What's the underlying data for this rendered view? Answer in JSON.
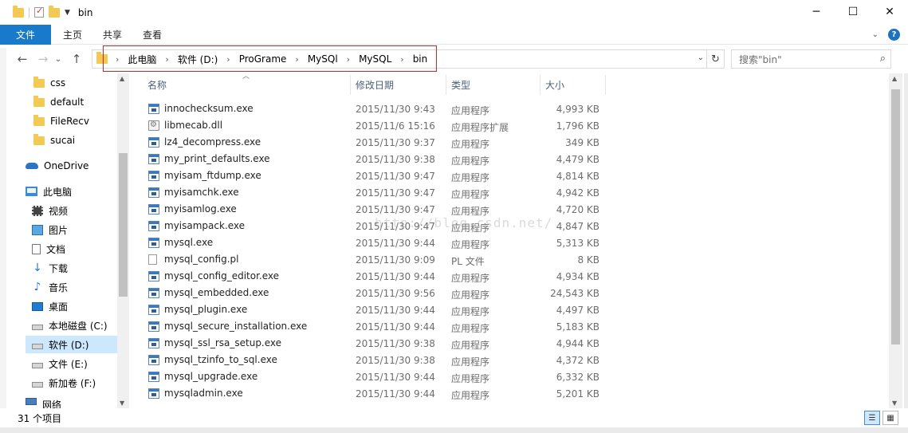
{
  "window": {
    "title": "bin",
    "minimize": "─",
    "maximize": "☐",
    "close": "✕"
  },
  "ribbon": {
    "tabs": [
      "文件",
      "主页",
      "共享",
      "查看"
    ],
    "help": "?",
    "expand": "⌄"
  },
  "nav": {
    "back": "←",
    "forward": "→",
    "dropdown": "⌄",
    "up": "↑",
    "breadcrumb": [
      "此电脑",
      "软件 (D:)",
      "ProGrame",
      "MySQl",
      "MySQL",
      "bin"
    ],
    "refresh": "↻",
    "search_placeholder": "搜索\"bin\""
  },
  "sidebar": {
    "folders": [
      "css",
      "default",
      "FileRecv",
      "sucai"
    ],
    "onedrive": "OneDrive",
    "this_pc": "此电脑",
    "pc_items": [
      "视频",
      "图片",
      "文档",
      "下载",
      "音乐",
      "桌面"
    ],
    "drives": [
      "本地磁盘 (C:)",
      "软件 (D:)",
      "文件 (E:)",
      "新加卷 (F:)"
    ],
    "network": "网络"
  },
  "columns": {
    "name": "名称",
    "date": "修改日期",
    "type": "类型",
    "size": "大小"
  },
  "files": [
    {
      "name": "innochecksum.exe",
      "date": "2015/11/30 9:43",
      "type": "应用程序",
      "size": "4,993 KB",
      "icon": "exe-icon"
    },
    {
      "name": "libmecab.dll",
      "date": "2015/11/6 15:16",
      "type": "应用程序扩展",
      "size": "1,796 KB",
      "icon": "dll-icon"
    },
    {
      "name": "lz4_decompress.exe",
      "date": "2015/11/30 9:37",
      "type": "应用程序",
      "size": "349 KB",
      "icon": "exe-icon"
    },
    {
      "name": "my_print_defaults.exe",
      "date": "2015/11/30 9:38",
      "type": "应用程序",
      "size": "4,479 KB",
      "icon": "exe-icon"
    },
    {
      "name": "myisam_ftdump.exe",
      "date": "2015/11/30 9:47",
      "type": "应用程序",
      "size": "4,814 KB",
      "icon": "exe-icon"
    },
    {
      "name": "myisamchk.exe",
      "date": "2015/11/30 9:47",
      "type": "应用程序",
      "size": "4,942 KB",
      "icon": "exe-icon"
    },
    {
      "name": "myisamlog.exe",
      "date": "2015/11/30 9:47",
      "type": "应用程序",
      "size": "4,720 KB",
      "icon": "exe-icon"
    },
    {
      "name": "myisampack.exe",
      "date": "2015/11/30 9:47",
      "type": "应用程序",
      "size": "4,847 KB",
      "icon": "exe-icon"
    },
    {
      "name": "mysql.exe",
      "date": "2015/11/30 9:44",
      "type": "应用程序",
      "size": "5,313 KB",
      "icon": "exe-icon"
    },
    {
      "name": "mysql_config.pl",
      "date": "2015/11/30 9:09",
      "type": "PL 文件",
      "size": "8 KB",
      "icon": "file-icon"
    },
    {
      "name": "mysql_config_editor.exe",
      "date": "2015/11/30 9:44",
      "type": "应用程序",
      "size": "4,934 KB",
      "icon": "exe-icon"
    },
    {
      "name": "mysql_embedded.exe",
      "date": "2015/11/30 9:56",
      "type": "应用程序",
      "size": "24,543 KB",
      "icon": "exe-icon"
    },
    {
      "name": "mysql_plugin.exe",
      "date": "2015/11/30 9:44",
      "type": "应用程序",
      "size": "4,497 KB",
      "icon": "exe-icon"
    },
    {
      "name": "mysql_secure_installation.exe",
      "date": "2015/11/30 9:44",
      "type": "应用程序",
      "size": "5,183 KB",
      "icon": "exe-icon"
    },
    {
      "name": "mysql_ssl_rsa_setup.exe",
      "date": "2015/11/30 9:38",
      "type": "应用程序",
      "size": "4,944 KB",
      "icon": "exe-icon"
    },
    {
      "name": "mysql_tzinfo_to_sql.exe",
      "date": "2015/11/30 9:38",
      "type": "应用程序",
      "size": "4,372 KB",
      "icon": "exe-icon"
    },
    {
      "name": "mysql_upgrade.exe",
      "date": "2015/11/30 9:44",
      "type": "应用程序",
      "size": "6,332 KB",
      "icon": "exe-icon"
    },
    {
      "name": "mysqladmin.exe",
      "date": "2015/11/30 9:44",
      "type": "应用程序",
      "size": "5,201 KB",
      "icon": "exe-icon"
    }
  ],
  "watermark": "http://blog.csdn.net/",
  "status": {
    "count": "31 个项目"
  },
  "colors": {
    "file_tab": "#1979ca",
    "highlight_box": "#e02020",
    "selected_nav": "#cce8ff",
    "header_text": "#4c607a"
  }
}
